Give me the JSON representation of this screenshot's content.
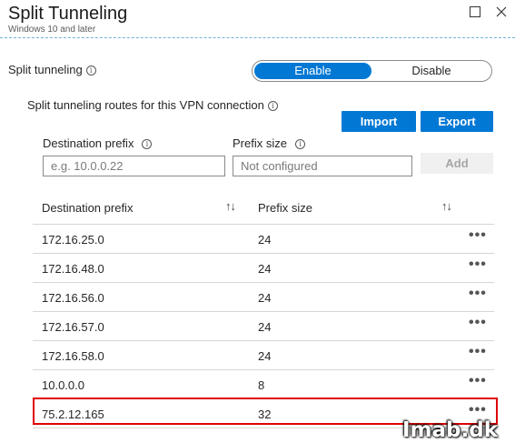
{
  "header": {
    "title": "Split Tunneling",
    "subtitle": "Windows 10 and later"
  },
  "split_tunneling": {
    "label": "Split tunneling",
    "enable_label": "Enable",
    "disable_label": "Disable",
    "selected": "Enable"
  },
  "routes": {
    "label": "Split tunneling routes for this VPN connection",
    "import_label": "Import",
    "export_label": "Export"
  },
  "form": {
    "dest_label": "Destination prefix",
    "dest_placeholder": "e.g. 10.0.0.22",
    "size_label": "Prefix size",
    "size_value": "Not configured",
    "add_label": "Add"
  },
  "table": {
    "col_dest": "Destination prefix",
    "col_size": "Prefix size",
    "sort_glyph": "↑↓",
    "more_glyph": "•••",
    "rows": [
      {
        "dest": "172.16.25.0",
        "size": "24"
      },
      {
        "dest": "172.16.48.0",
        "size": "24"
      },
      {
        "dest": "172.16.56.0",
        "size": "24"
      },
      {
        "dest": "172.16.57.0",
        "size": "24"
      },
      {
        "dest": "172.16.58.0",
        "size": "24"
      },
      {
        "dest": "10.0.0.0",
        "size": "8"
      },
      {
        "dest": "75.2.12.165",
        "size": "32"
      }
    ]
  },
  "watermark": "Imab.dk",
  "colors": {
    "accent": "#0078d4",
    "highlight": "#e00000",
    "header_border": "#6fb3d8"
  }
}
